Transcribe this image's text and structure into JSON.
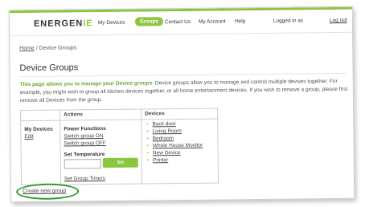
{
  "nav": {
    "logo_text": "ENERGENIE",
    "items": [
      {
        "label": "My Devices",
        "active": false
      },
      {
        "label": "Groups",
        "active": true
      },
      {
        "label": "Contact Us",
        "active": false
      },
      {
        "label": "My Account",
        "active": false
      },
      {
        "label": "Help",
        "active": false
      }
    ],
    "login_text": "Logged in as",
    "logout_label": "Log out"
  },
  "breadcrumb": {
    "home": "Home",
    "separator": " / ",
    "current": "Device Groups"
  },
  "page": {
    "title": "Device Groups",
    "intro_lead": "This page allows you to manage your Device groups.",
    "intro_body": " Device groups allow you to manage and control multiple devives together. For example, you might wish to group all kitchen devices together, or all home entertainment devices. If you wish to remove a group, please first remove all Devices from the group."
  },
  "table": {
    "headers": {
      "group": "",
      "actions": "Actions",
      "devices": "Devices"
    },
    "group": {
      "name": "My Devices",
      "edit_label": "Edit"
    },
    "actions": {
      "power_functions_title": "Power Functions",
      "switch_on_label": "Switch group ON",
      "switch_off_label": "Switch group OFF",
      "set_temperature_title": "Set Temperature",
      "temperature_value": "",
      "set_button_label": "Set",
      "group_timers_label": "Set Group Timers"
    },
    "devices": [
      "Back door",
      "Living Room",
      "Bedroom",
      "Whole House Monitor",
      "New Device",
      "Printer"
    ]
  },
  "create_group_label": "Create new group",
  "colors": {
    "accent": "#8cc63f",
    "highlight_ring": "#2e9b2e"
  }
}
